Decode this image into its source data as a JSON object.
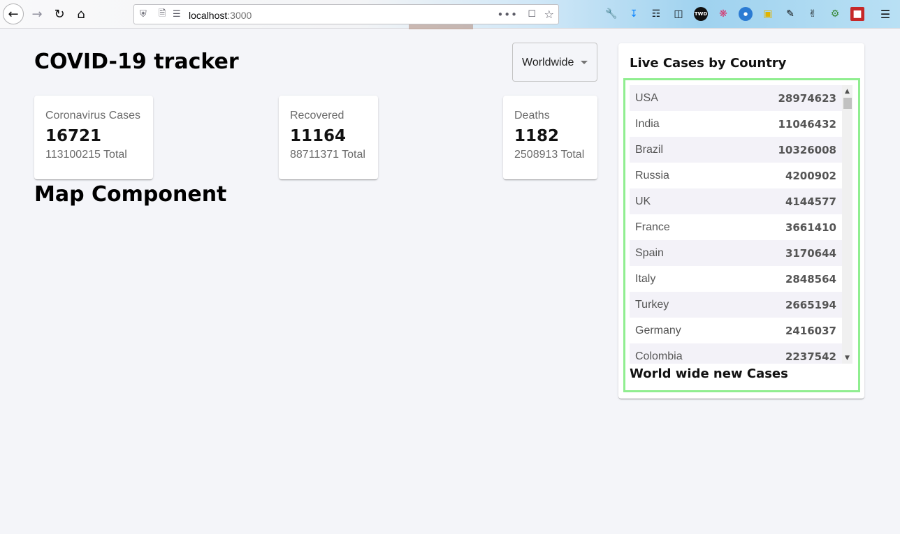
{
  "browser": {
    "url_host": "localhost",
    "url_port": ":3000",
    "icons": [
      "back-icon",
      "forward-icon",
      "reload-icon",
      "home-icon",
      "shield-icon",
      "page-icon",
      "permissions-icon",
      "more-icon",
      "pocket-icon",
      "bookmark-star-icon",
      "wrench-icon",
      "download-icon",
      "library-icon",
      "sidebar-icon",
      "hamburger-menu-icon"
    ]
  },
  "header": {
    "title": "COVID-19 tracker",
    "country_select": {
      "value": "Worldwide"
    }
  },
  "cards": [
    {
      "title": "Coronavirus Cases",
      "count": "16721",
      "total": "113100215 Total"
    },
    {
      "title": "Recovered",
      "count": "11164",
      "total": "88711371 Total"
    },
    {
      "title": "Deaths",
      "count": "1182",
      "total": "2508913 Total"
    }
  ],
  "map": {
    "heading": "Map Component"
  },
  "sidebar": {
    "heading": "Live Cases by Country",
    "countries": [
      {
        "name": "USA",
        "cases": "28974623"
      },
      {
        "name": "India",
        "cases": "11046432"
      },
      {
        "name": "Brazil",
        "cases": "10326008"
      },
      {
        "name": "Russia",
        "cases": "4200902"
      },
      {
        "name": "UK",
        "cases": "4144577"
      },
      {
        "name": "France",
        "cases": "3661410"
      },
      {
        "name": "Spain",
        "cases": "3170644"
      },
      {
        "name": "Italy",
        "cases": "2848564"
      },
      {
        "name": "Turkey",
        "cases": "2665194"
      },
      {
        "name": "Germany",
        "cases": "2416037"
      },
      {
        "name": "Colombia",
        "cases": "2237542"
      }
    ],
    "chart_heading": "World wide new Cases"
  },
  "colors": {
    "highlight_border": "#90ee90",
    "page_background": "#f4f5f9",
    "row_stripe": "#f3f2f8"
  }
}
